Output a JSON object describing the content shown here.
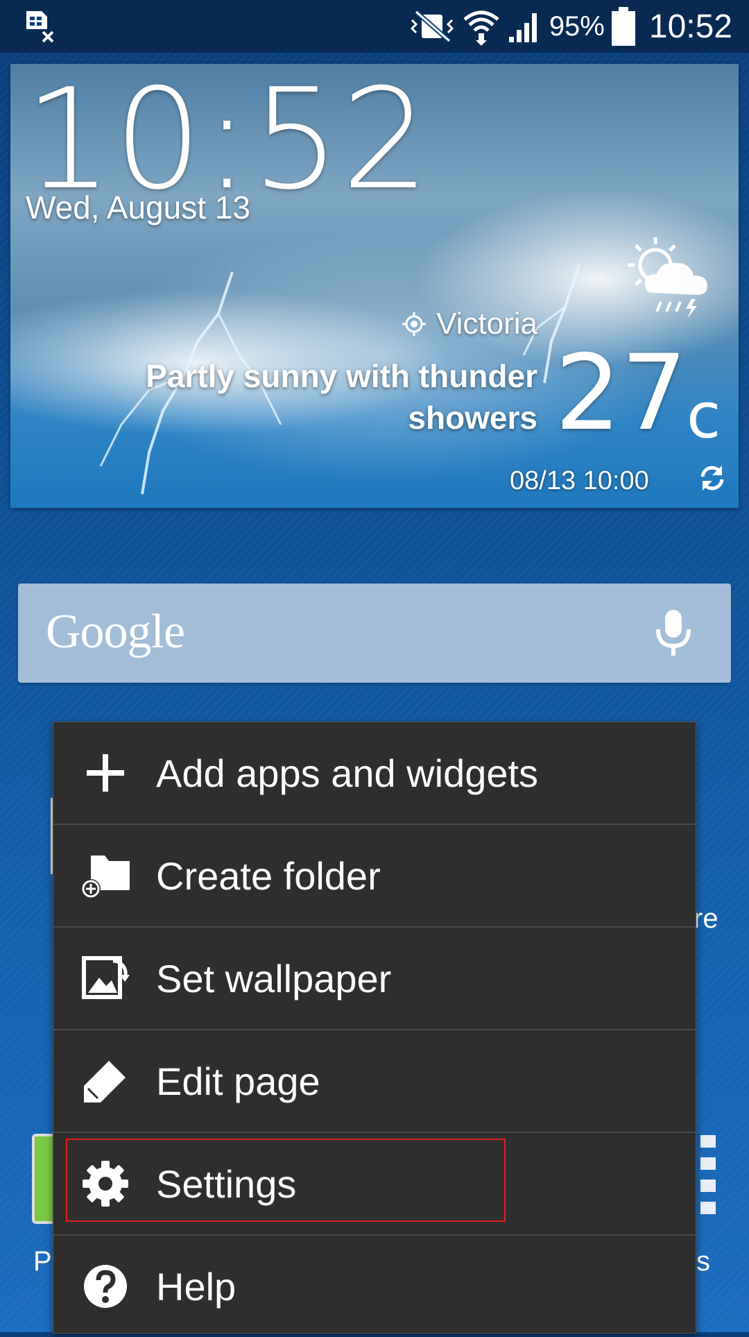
{
  "status_bar": {
    "battery_percent": "95%",
    "time": "10:52",
    "icons": [
      "sim-error-icon",
      "vibrate-mute-icon",
      "wifi-icon",
      "signal-icon",
      "battery-icon"
    ]
  },
  "weather_widget": {
    "time": "10:52",
    "date": "Wed, August 13",
    "location": "Victoria",
    "condition": "Partly sunny with thunder showers",
    "temperature": "27",
    "degree_symbol": "°",
    "unit": "c",
    "updated": "08/13 10:00"
  },
  "google_search": {
    "logo": "Google"
  },
  "background": {
    "peek_right_text": "re",
    "peek_bottom_left": "P",
    "peek_bottom_right": "s"
  },
  "menu": {
    "items": [
      {
        "label": "Add apps and widgets",
        "icon": "plus-icon"
      },
      {
        "label": "Create folder",
        "icon": "folder-add-icon"
      },
      {
        "label": "Set wallpaper",
        "icon": "wallpaper-icon"
      },
      {
        "label": "Edit page",
        "icon": "pencil-icon"
      },
      {
        "label": "Settings",
        "icon": "gear-icon"
      },
      {
        "label": "Help",
        "icon": "help-icon"
      }
    ]
  },
  "colors": {
    "menu_bg": "#2e2e2e",
    "highlight": "#e02020",
    "search_bg": "#a2bdd7"
  }
}
